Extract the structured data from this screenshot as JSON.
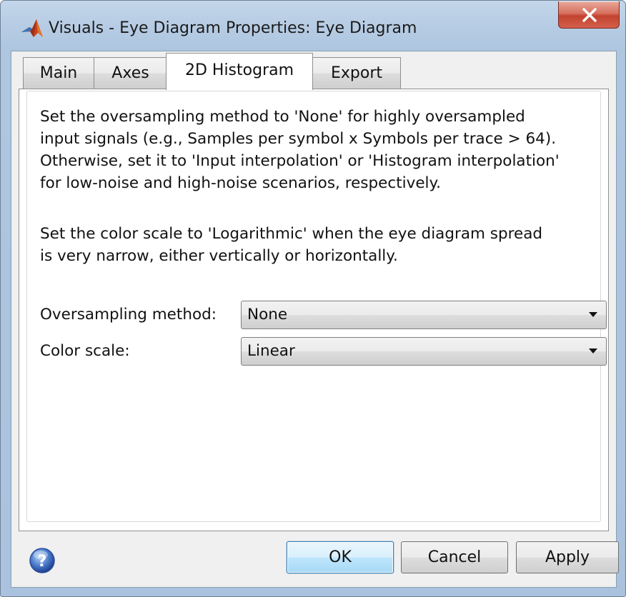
{
  "window": {
    "title": "Visuals - Eye Diagram Properties: Eye Diagram",
    "app_icon": "matlab-logo-icon",
    "close_icon": "close-icon"
  },
  "tabs": [
    {
      "label": "Main",
      "active": false
    },
    {
      "label": "Axes",
      "active": false
    },
    {
      "label": "2D Histogram",
      "active": true
    },
    {
      "label": "Export",
      "active": false
    }
  ],
  "panel": {
    "paragraph1": [
      "Set the oversampling method to 'None' for highly oversampled",
      "input signals (e.g., Samples per symbol x Symbols per trace > 64).",
      "Otherwise, set it to 'Input interpolation' or 'Histogram interpolation'",
      "for low-noise and high-noise scenarios, respectively."
    ],
    "paragraph2": [
      "Set the color scale to 'Logarithmic' when the eye diagram spread",
      "is very narrow, either vertically or horizontally."
    ],
    "oversampling": {
      "label": "Oversampling method:",
      "value": "None"
    },
    "color_scale": {
      "label": "Color scale:",
      "value": "Linear"
    }
  },
  "footer": {
    "help_icon": "help-icon",
    "ok_label": "OK",
    "cancel_label": "Cancel",
    "apply_label": "Apply"
  },
  "colors": {
    "window_frame": "#b5cbe3",
    "close_button": "#c2432f",
    "ok_highlight": "#3c7fb1",
    "panel_background": "#ffffff"
  }
}
